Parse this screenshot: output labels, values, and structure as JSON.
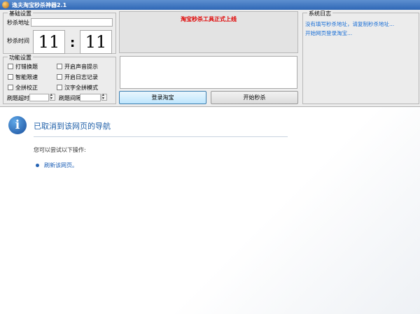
{
  "window": {
    "title": "逸夫淘宝秒杀神器2.1"
  },
  "basic": {
    "legend": "基础设置",
    "url_label": "秒杀地址",
    "url_value": "",
    "time_label": "秒杀时间",
    "hour": "11",
    "minute": "11",
    "colon": ":"
  },
  "features": {
    "legend": "功能设置",
    "checkboxes": [
      {
        "label": "打错换题",
        "checked": false
      },
      {
        "label": "开启声音提示",
        "checked": false
      },
      {
        "label": "智能限速",
        "checked": false
      },
      {
        "label": "开启日志记录",
        "checked": false
      },
      {
        "label": "全拼校正",
        "checked": false
      },
      {
        "label": "汉字全拼模式",
        "checked": false
      }
    ],
    "refresh_timeout_label": "刷题超时",
    "refresh_interval_label": "刷题间隔"
  },
  "announcement": "淘宝秒杀工具正式上线",
  "buttons": {
    "login": "登录淘宝",
    "start": "开始秒杀"
  },
  "log": {
    "legend": "系统日志",
    "lines": [
      "没有填写秒杀地址，请复制秒杀地址...",
      "开始网页登录淘宝..."
    ]
  },
  "browser": {
    "title": "已取消到该网页的导航",
    "subtitle": "您可以尝试以下操作:",
    "refresh_link": "刷新该网页。"
  },
  "colors": {
    "accent": "#1f5fa8",
    "announcement": "#e00000",
    "log_text": "#1a6fd6"
  }
}
